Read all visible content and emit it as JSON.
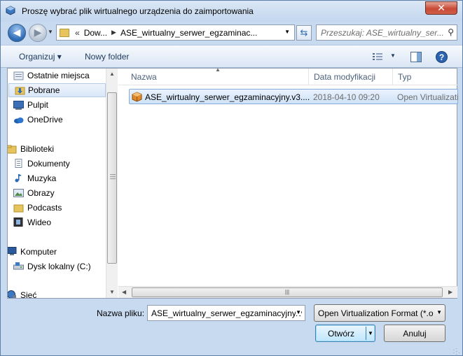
{
  "window": {
    "title": "Proszę wybrać plik wirtualnego urządzenia do zaimportowania",
    "close_glyph": "✕"
  },
  "navbar": {
    "back_glyph": "◀",
    "forward_glyph": "▶",
    "breadcrumb_prefix": "«",
    "breadcrumb": [
      "Dow...",
      "ASE_wirtualny_serwer_egzaminac..."
    ],
    "search_placeholder": "Przeszukaj: ASE_wirtualny_ser..."
  },
  "toolbar": {
    "organize": "Organizuj ▾",
    "new_folder": "Nowy folder",
    "help_glyph": "?"
  },
  "nav_pane": {
    "items": [
      {
        "label": "Ostatnie miejsca",
        "icon": "recent-places-icon"
      },
      {
        "label": "Pobrane",
        "icon": "downloads-folder-icon",
        "selected": true
      },
      {
        "label": "Pulpit",
        "icon": "desktop-icon"
      },
      {
        "label": "OneDrive",
        "icon": "onedrive-icon"
      },
      {
        "label": "Biblioteki",
        "icon": "libraries-icon"
      },
      {
        "label": "Dokumenty",
        "icon": "documents-icon"
      },
      {
        "label": "Muzyka",
        "icon": "music-icon"
      },
      {
        "label": "Obrazy",
        "icon": "pictures-icon"
      },
      {
        "label": "Podcasts",
        "icon": "podcasts-folder-icon"
      },
      {
        "label": "Wideo",
        "icon": "videos-icon"
      },
      {
        "label": "Komputer",
        "icon": "computer-icon"
      },
      {
        "label": "Dysk lokalny (C:)",
        "icon": "local-disk-icon"
      },
      {
        "label": "Sieć",
        "icon": "network-icon"
      }
    ]
  },
  "file_list": {
    "columns": [
      "Nazwa",
      "Data modyfikacji",
      "Typ"
    ],
    "rows": [
      {
        "name": "ASE_wirtualny_serwer_egzaminacyjny.v3....",
        "modified": "2018-04-10 09:20",
        "type": "Open Virtualizati",
        "icon": "ova-package-icon",
        "selected": true
      }
    ]
  },
  "footer": {
    "filename_label": "Nazwa pliku:",
    "filename_value": "ASE_wirtualny_serwer_egzaminacyjny.v",
    "filter_value": "Open Virtualization Format (*.o",
    "open_label": "Otwórz",
    "cancel_label": "Anuluj"
  },
  "colors": {
    "accent": "#2e6bb5",
    "selection": "#cfe2f7",
    "close": "#c74a36"
  }
}
